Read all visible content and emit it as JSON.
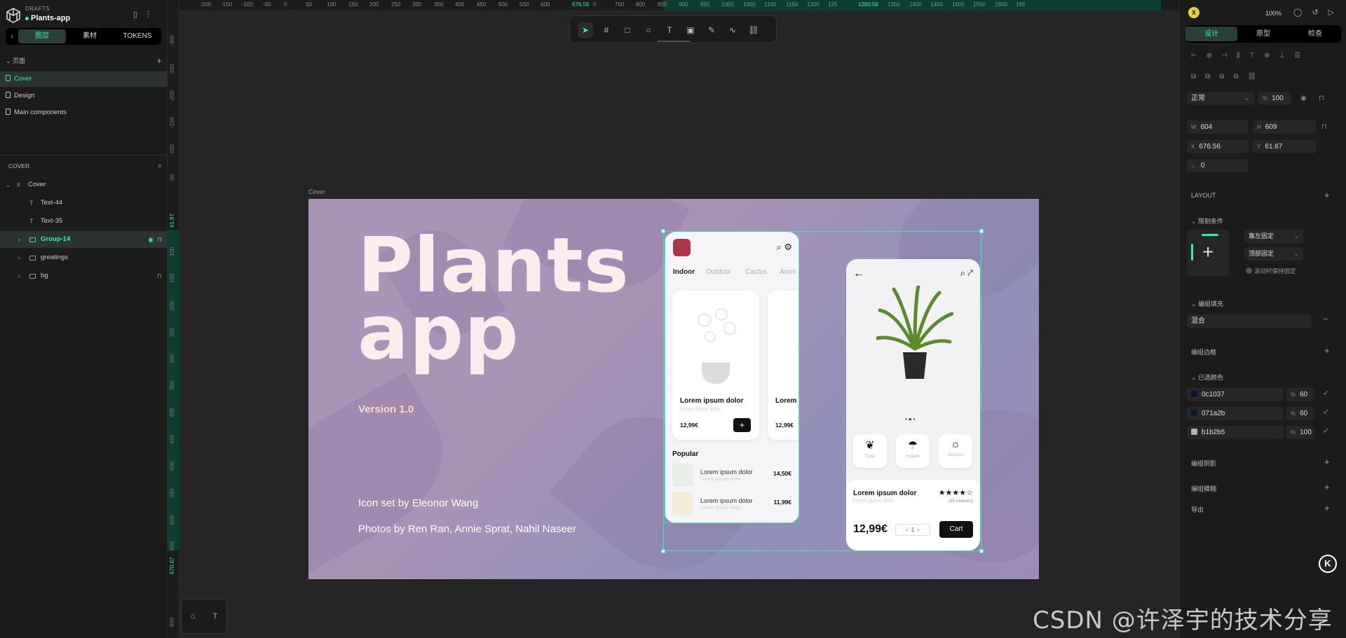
{
  "app": {
    "drafts_label": "DRAFTS",
    "project_name": "Plants-app"
  },
  "left_tabs": [
    "图层",
    "素材",
    "TOKENS"
  ],
  "pages_section": {
    "title": "页面",
    "items": [
      "Cover",
      "Design",
      "Main components"
    ]
  },
  "layers_section": {
    "title": "COVER",
    "items": [
      {
        "name": "Cover",
        "type": "frame"
      },
      {
        "name": "Text-44",
        "type": "text"
      },
      {
        "name": "Text-35",
        "type": "text"
      },
      {
        "name": "Group-14",
        "type": "group"
      },
      {
        "name": "greatings",
        "type": "group"
      },
      {
        "name": "bg",
        "type": "group"
      }
    ]
  },
  "h_ruler": [
    "-200",
    "-150",
    "-100",
    "-50",
    "0",
    "50",
    "100",
    "150",
    "200",
    "250",
    "300",
    "350",
    "400",
    "450",
    "500",
    "550",
    "600",
    "676.56",
    "0",
    "750",
    "800",
    "850",
    "900",
    "950",
    "1000",
    "1050",
    "1100",
    "1150",
    "1200",
    "125",
    "1280.56",
    "1350",
    "1400",
    "1450",
    "1500",
    "1550",
    "1600",
    "165"
  ],
  "v_ruler": [
    "-300",
    "-250",
    "-200",
    "-150",
    "-100",
    "-50",
    "61.67",
    "100",
    "150",
    "200",
    "250",
    "300",
    "350",
    "400",
    "450",
    "500",
    "550",
    "600",
    "650",
    "670.67",
    "800"
  ],
  "canvas": {
    "artboard_label": "Cover",
    "title_line1": "Plants",
    "title_line2": "app",
    "version": "Version 1.0",
    "credit1": "Icon set by Eleonor Wang",
    "credit2": "Photos by  Ren Ran,  Annie Sprat,  Nahil Naseer"
  },
  "phone1": {
    "tabs": [
      "Indoor",
      "Outdoor",
      "Cactus",
      "Arom"
    ],
    "card_title": "Lorem ipsum dolor",
    "card_sub": "Lorem ipsum dolor",
    "card_price": "12,99€",
    "card2_title": "Lorem",
    "card2_price": "12,99€",
    "popular_title": "Popular",
    "popular": [
      {
        "name": "Lorem ipsum dolor",
        "sub": "Lorem ipsum dolor",
        "price": "14,50€"
      },
      {
        "name": "Lorem ipsum dolor",
        "sub": "Lorem ipsum dolor",
        "price": "11,99€"
      }
    ]
  },
  "phone2": {
    "features": [
      "Type",
      "Irrigate",
      "Season"
    ],
    "name": "Lorem ipsum dolor",
    "sub": "Lorem ipsum dolor",
    "stars": "★★★★☆",
    "reviews": "(45 reviews)",
    "price": "12,99€",
    "qty": "1",
    "cart": "Cart"
  },
  "right": {
    "avatar": "X",
    "zoom": "100%",
    "tabs": [
      "设计",
      "原型",
      "检查"
    ],
    "blend": "正常",
    "opacity": "100",
    "w": "604",
    "h": "609",
    "x": "676.56",
    "y": "61.67",
    "rotation": "0",
    "layout_title": "LAYOUT",
    "constraints_title": "限制条件",
    "constraint_h": "靠左固定",
    "constraint_v": "顶部固定",
    "scroll_fixed": "滚动时保持固定",
    "fill_title": "编组填充",
    "fill_value": "混合",
    "stroke_title": "编组边框",
    "selected_colors_title": "已选颜色",
    "colors": [
      {
        "hex": "0c1037",
        "opacity": "60",
        "swatch": "#0c1037"
      },
      {
        "hex": "071a2b",
        "opacity": "60",
        "swatch": "#071a2b"
      },
      {
        "hex": "b1b2b5",
        "opacity": "100",
        "swatch": "#b1b2b5"
      }
    ],
    "shadow_title": "编组阴影",
    "blur_title": "编组模糊",
    "export_title": "导出",
    "badge": "K"
  },
  "watermark": "CSDN @许泽宇的技术分享",
  "colors": {
    "accent": "#31efb8",
    "bg": "#252525",
    "panel": "#1b1b1b"
  }
}
